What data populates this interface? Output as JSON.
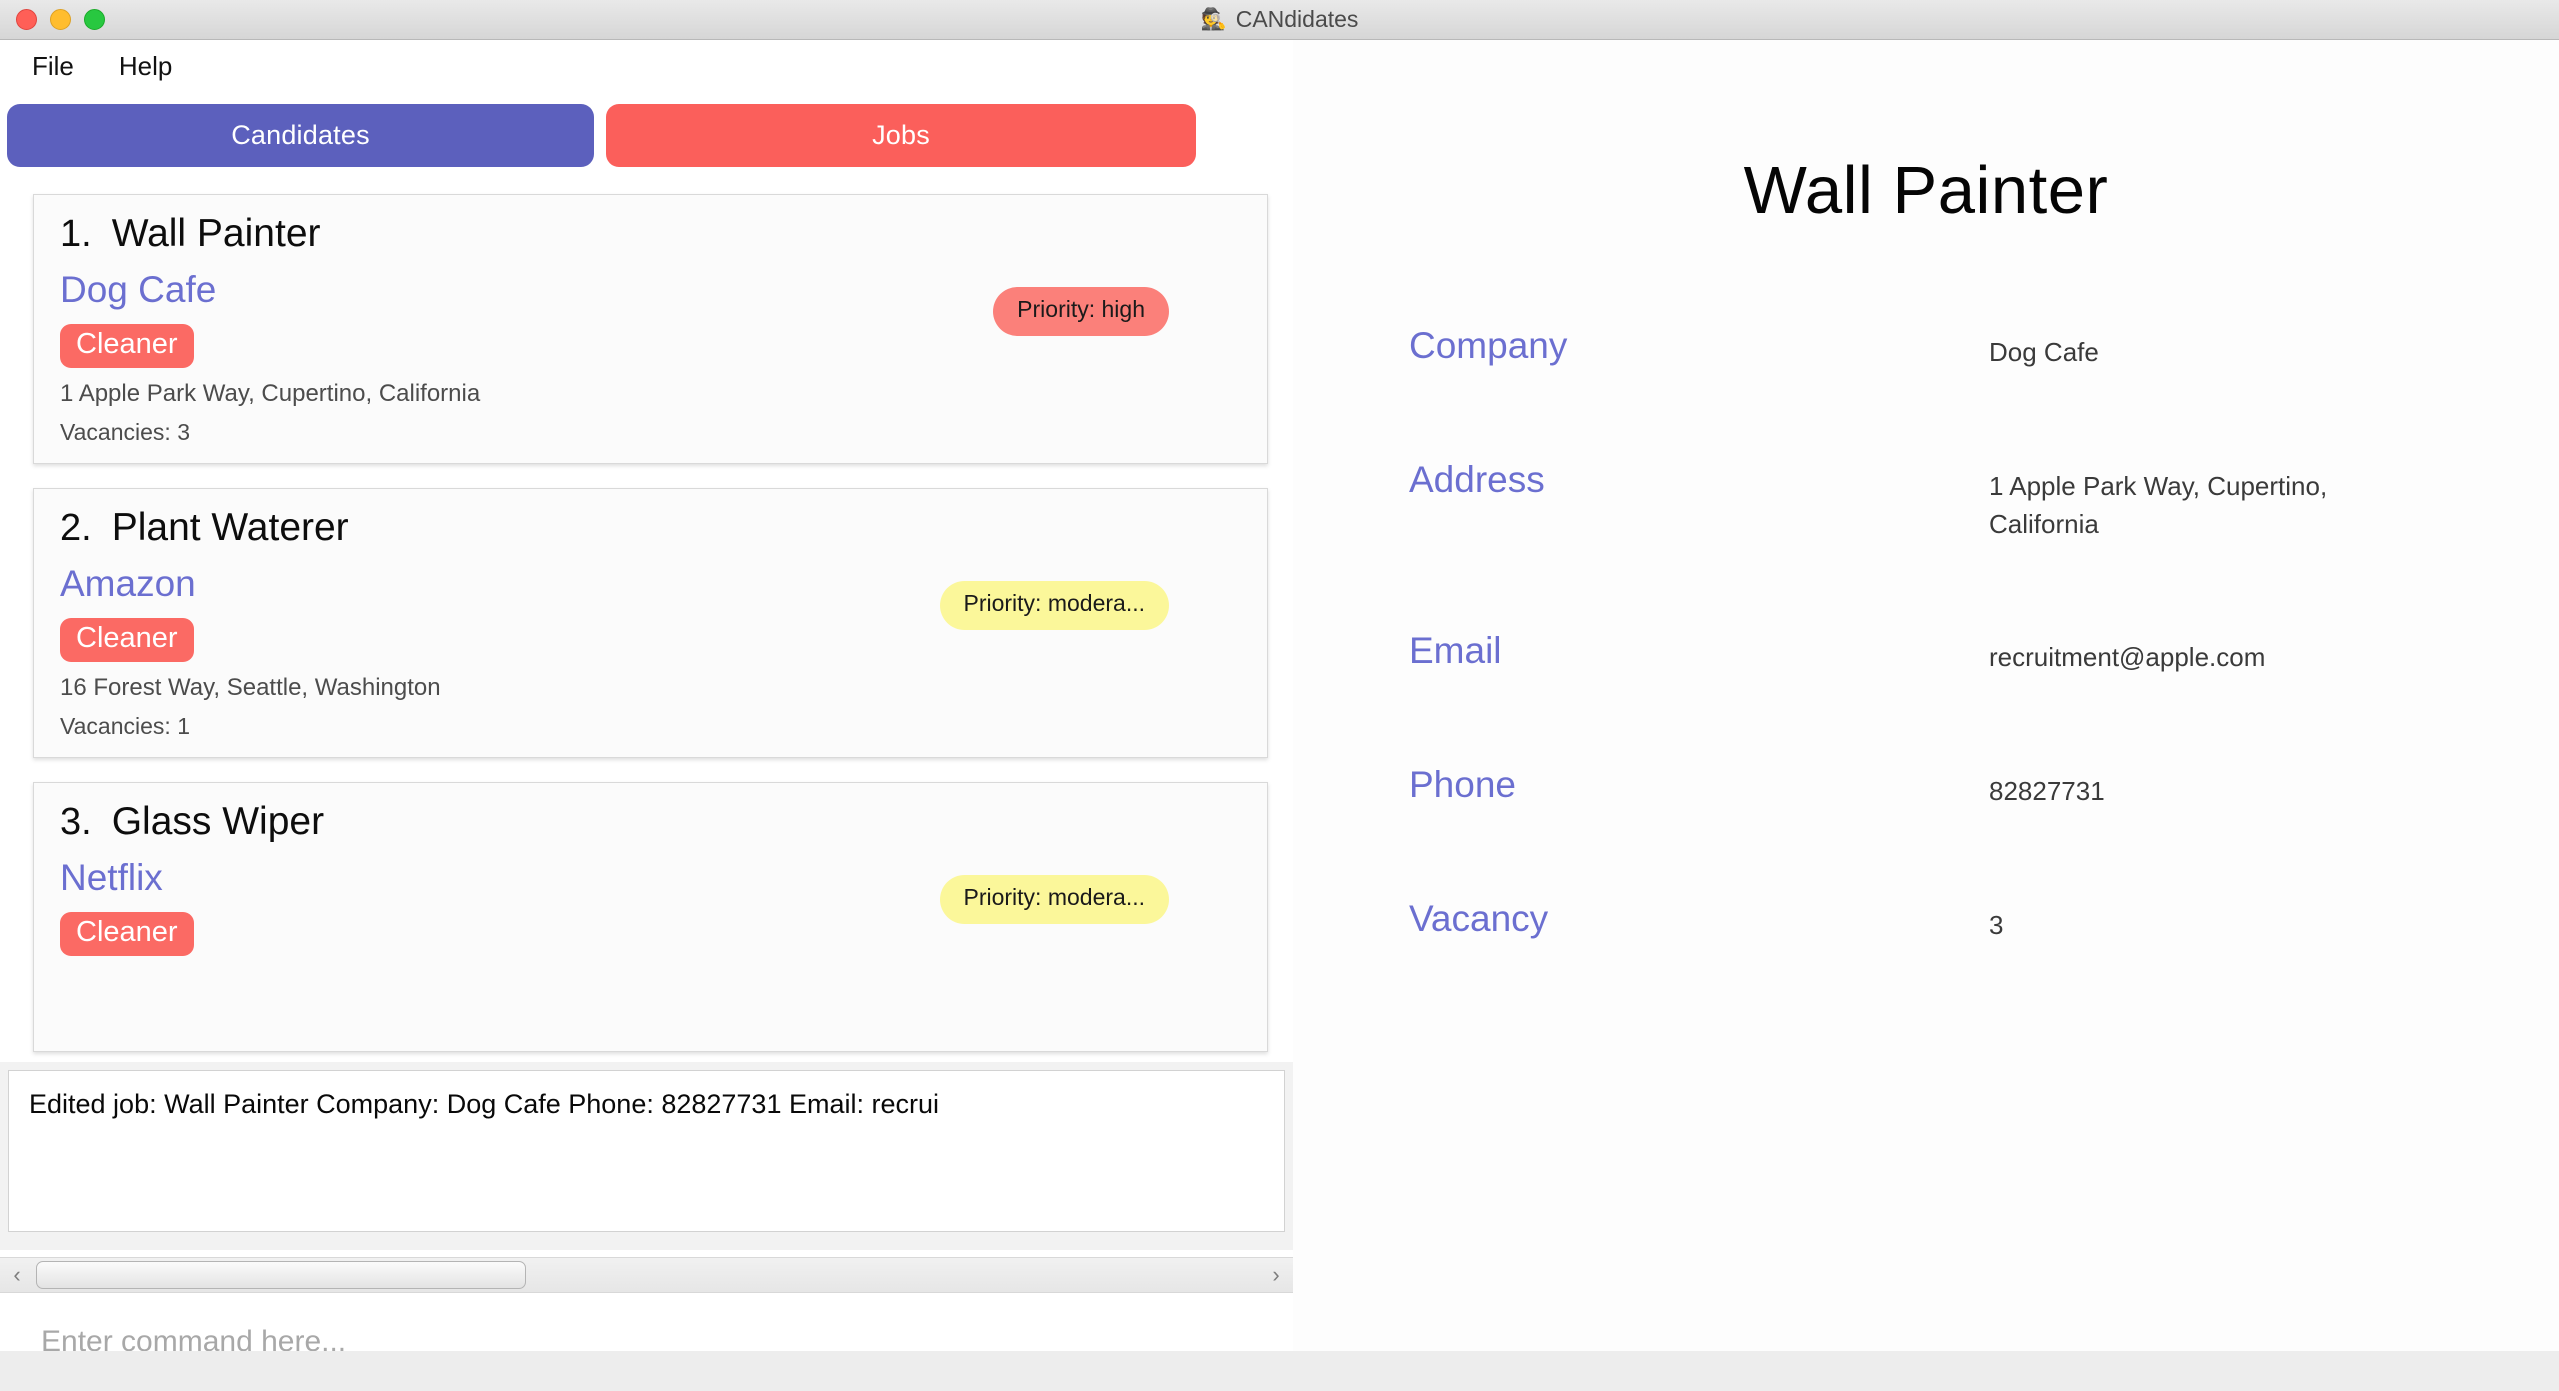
{
  "window": {
    "title": "CANdidates",
    "app_icon": "candidates-app-icon",
    "traffic_lights": [
      "close",
      "minimize",
      "maximize"
    ]
  },
  "menubar": {
    "items": [
      {
        "label": "File"
      },
      {
        "label": "Help"
      }
    ]
  },
  "tabs": [
    {
      "label": "Candidates",
      "color": "#5c60bd",
      "active": false
    },
    {
      "label": "Jobs",
      "color": "#fb5f5b",
      "active": true
    }
  ],
  "job_list": [
    {
      "index": "1.",
      "title": "Wall Painter",
      "company": "Dog Cafe",
      "tag": "Cleaner",
      "priority": "Priority: high",
      "priority_level": "high",
      "address": "1 Apple Park Way, Cupertino, California",
      "vacancies": "Vacancies: 3"
    },
    {
      "index": "2.",
      "title": "Plant Waterer",
      "company": "Amazon",
      "tag": "Cleaner",
      "priority": "Priority: modera...",
      "priority_level": "moderate",
      "address": "16 Forest Way, Seattle, Washington",
      "vacancies": "Vacancies: 1"
    },
    {
      "index": "3.",
      "title": "Glass Wiper",
      "company": "Netflix",
      "tag": "Cleaner",
      "priority": "Priority: modera...",
      "priority_level": "moderate",
      "address": "",
      "vacancies": ""
    }
  ],
  "result_panel": {
    "text": "Edited job: Wall Painter Company: Dog Cafe Phone: 82827731 Email: recrui"
  },
  "scrollbar": {
    "left_arrow": "‹",
    "right_arrow": "›"
  },
  "command_box": {
    "value": "",
    "placeholder": "Enter command here..."
  },
  "detail_panel": {
    "title": "Wall Painter",
    "rows": [
      {
        "label": "Company",
        "value": "Dog Cafe"
      },
      {
        "label": "Address",
        "value": "1 Apple Park Way, Cupertino, California"
      },
      {
        "label": "Email",
        "value": "recruitment@apple.com"
      },
      {
        "label": "Phone",
        "value": "82827731"
      },
      {
        "label": "Vacancy",
        "value": "3"
      }
    ]
  },
  "colors": {
    "accent_purple": "#6b6fd0",
    "tab_purple": "#5c60bd",
    "accent_red": "#fb5f5b",
    "tag_red": "#fb6a64",
    "priority_high": "#fb807a",
    "priority_moderate": "#fbf79a"
  }
}
